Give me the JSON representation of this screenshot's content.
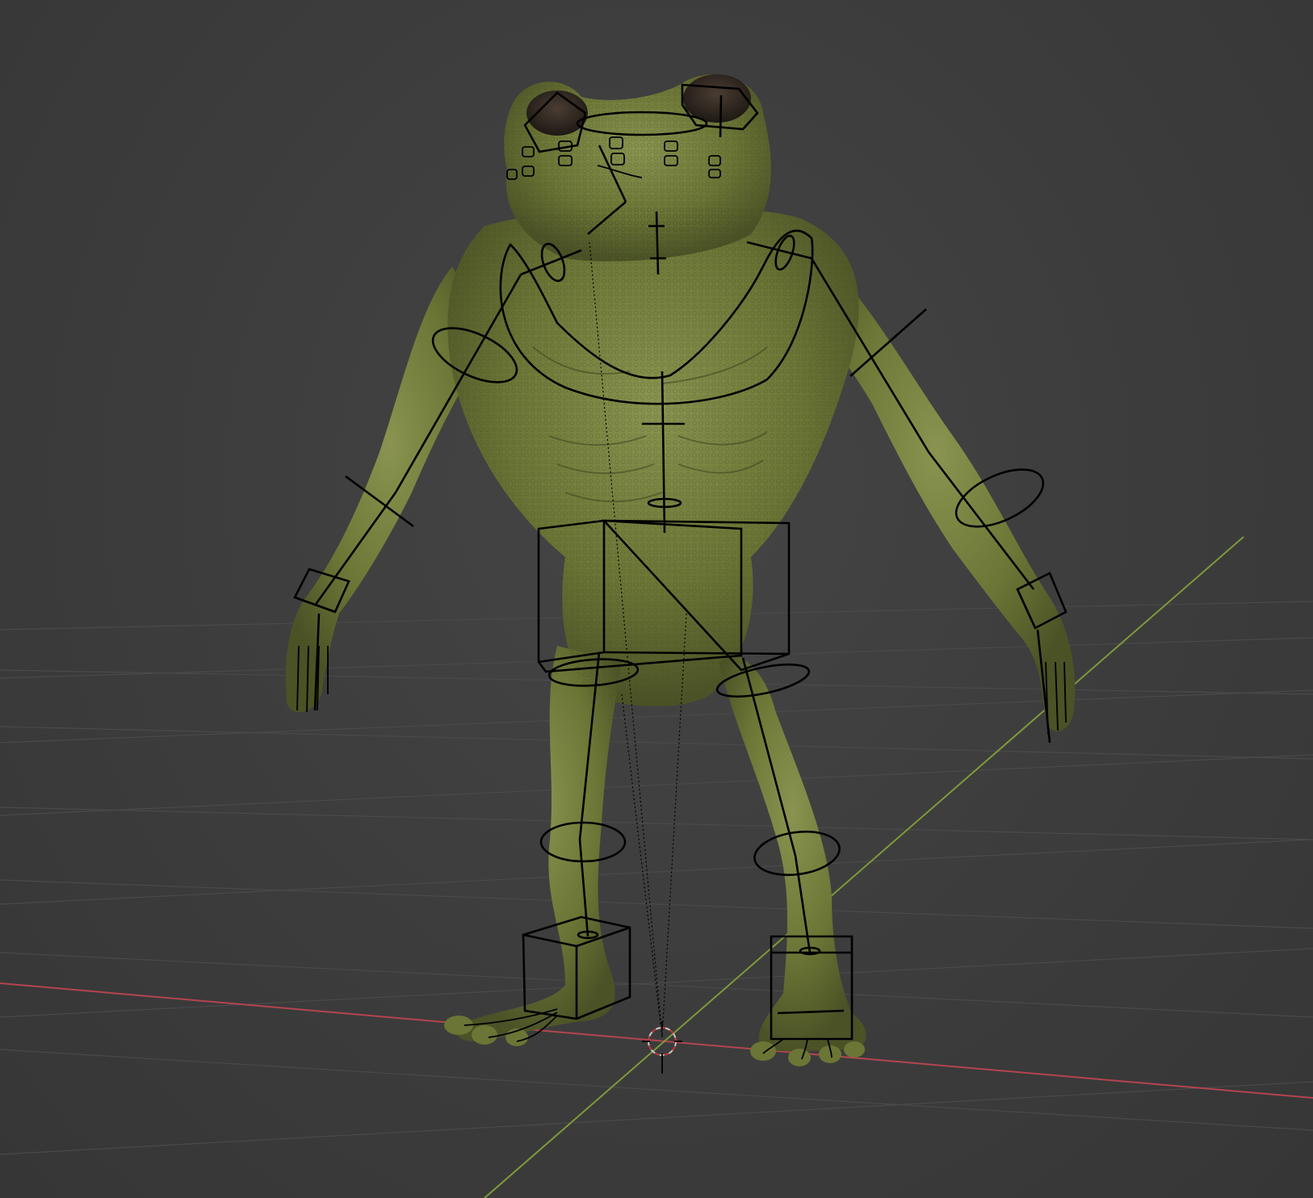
{
  "viewport": {
    "name": "3D Viewport",
    "background_color": "#3d3d3d",
    "grid_color": "#4a4a4a",
    "x_axis_color": "#b4444f",
    "y_axis_color": "#7d9a3a"
  },
  "character": {
    "name": "frog-character",
    "skin_color": "#6b7535",
    "skin_highlight": "#8a9450",
    "skin_shadow": "#3d4420",
    "eye_color": "#2e2722"
  },
  "armature": {
    "name": "rig-armature",
    "bone_color": "#000000"
  },
  "cursor": {
    "name": "3d-cursor",
    "ring_color_a": "#c8c8c8",
    "ring_color_b": "#c23a3a"
  }
}
